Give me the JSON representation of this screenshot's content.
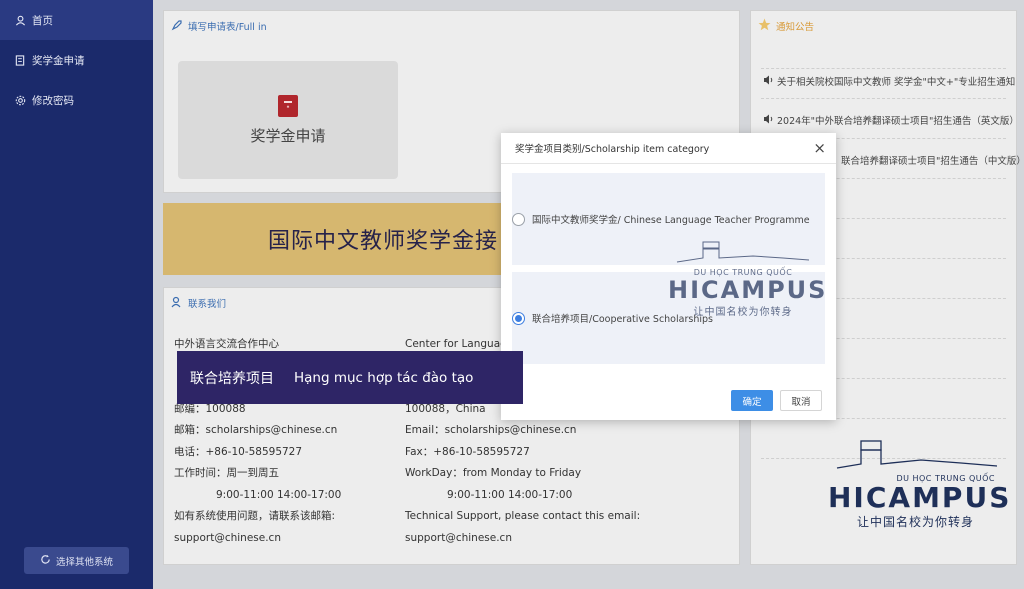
{
  "sidebar": {
    "items": [
      {
        "label": "首页",
        "icon": "home-icon"
      },
      {
        "label": "奖学金申请",
        "icon": "document-icon"
      },
      {
        "label": "修改密码",
        "icon": "gear-icon"
      }
    ],
    "switch_label": "选择其他系统"
  },
  "fill_panel": {
    "title": "填写申请表/Full in",
    "card_label": "奖学金申请"
  },
  "banner": {
    "text": "国际中文教师奖学金接"
  },
  "contact": {
    "title": "联系我们",
    "left": [
      "中外语言交流合作中心",
      "",
      "",
      "邮编：100088",
      "邮箱：scholarships@chinese.cn",
      "电话：+86-10-58595727",
      "工作时间：周一到周五",
      "　　　　9:00-11:00 14:00-17:00",
      "如有系统使用问题，请联系该邮箱:",
      "support@chinese.cn"
    ],
    "right": [
      "Center for Languag",
      "",
      "",
      "100088，China",
      "Email：scholarships@chinese.cn",
      "Fax：+86-10-58595727",
      "WorkDay：from Monday to Friday",
      "　　　　9:00-11:00 14:00-17:00",
      "Technical Support, please contact this email:",
      "support@chinese.cn"
    ]
  },
  "notices": {
    "title": "通知公告",
    "items": [
      "关于相关院校国际中文教师 奖学金\"中文+\"专业招生通知",
      "2024年\"中外联合培养翻译硕士项目\"招生通告（英文版）",
      "联合培养翻译硕士项目\"招生通告（中文版）"
    ]
  },
  "modal": {
    "title": "奖学金项目类别/Scholarship item category",
    "close": "×",
    "options": [
      {
        "label": "国际中文教师奖学金/ Chinese Language Teacher Programme",
        "selected": false
      },
      {
        "label": "联合培养项目/Cooperative Scholarships",
        "selected": true
      }
    ],
    "ok": "确定",
    "cancel": "取消"
  },
  "caption": {
    "zh": "联合培养项目",
    "vi": "Hạng mục hợp tác đào tạo"
  },
  "watermark": {
    "small": "DU HỌC TRUNG QUỐC",
    "brand": "HICAMPUS",
    "tagline": "让中国名校为你转身"
  },
  "colors": {
    "sidebar": "#1b2a6b",
    "accent": "#3d8ee6",
    "banner": "#d6b76f",
    "caption": "#2e2566"
  }
}
